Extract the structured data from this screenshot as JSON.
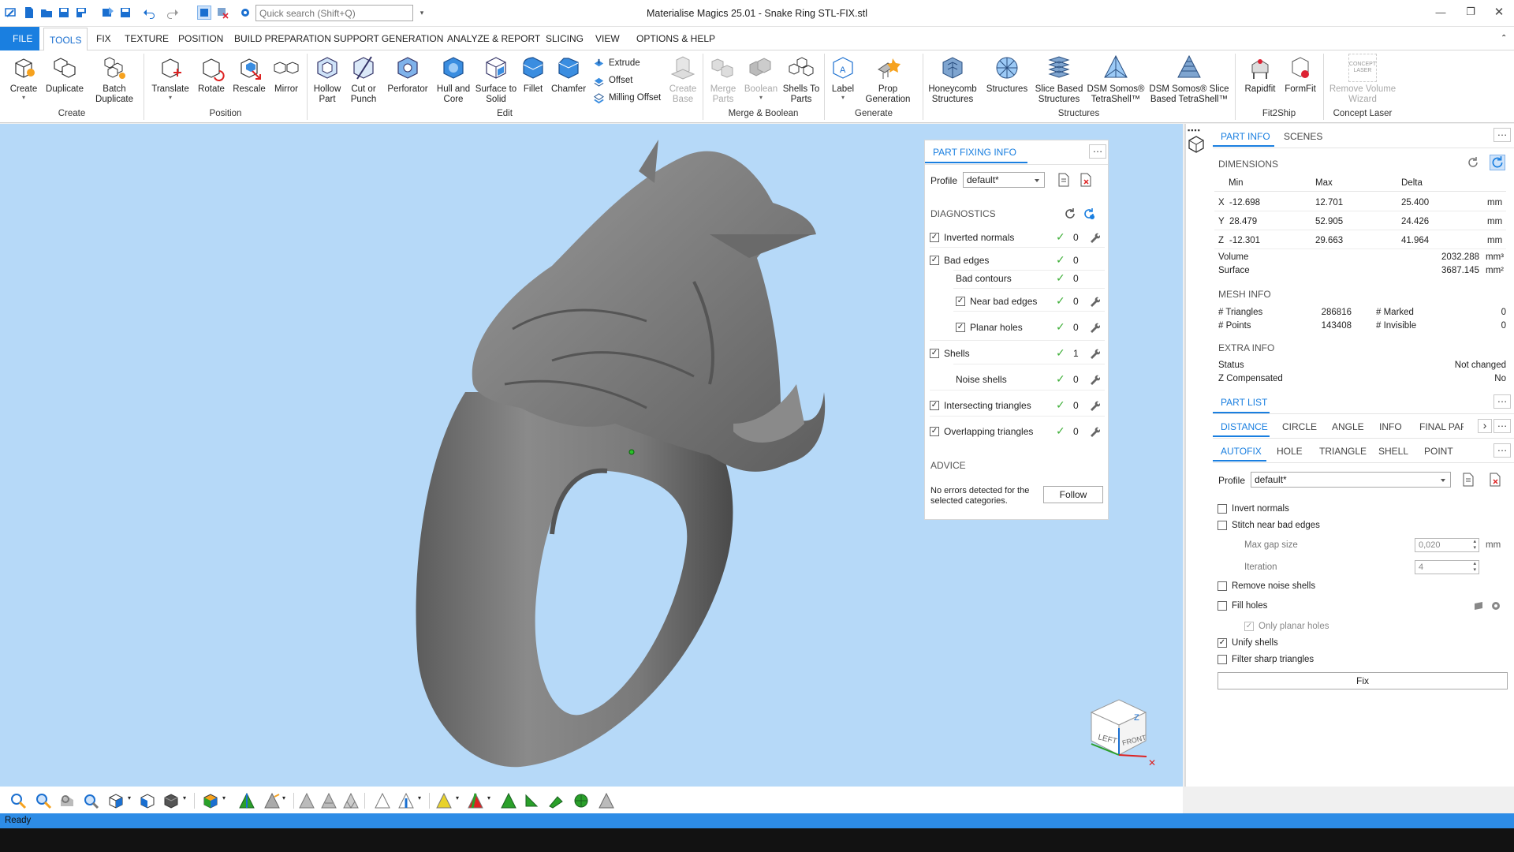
{
  "window": {
    "title": "Materialise Magics 25.01 - Snake Ring STL-FIX.stl",
    "search_placeholder": "Quick search (Shift+Q)"
  },
  "menu": [
    "FILE",
    "TOOLS",
    "FIX",
    "TEXTURE",
    "POSITION",
    "BUILD PREPARATION",
    "SUPPORT GENERATION",
    "ANALYZE & REPORT",
    "SLICING",
    "VIEW",
    "OPTIONS & HELP"
  ],
  "ribbon": {
    "create": {
      "create": "Create",
      "duplicate": "Duplicate",
      "batch_duplicate": "Batch\nDuplicate",
      "group": "Create"
    },
    "position": {
      "translate": "Translate",
      "rotate": "Rotate",
      "rescale": "Rescale",
      "mirror": "Mirror",
      "group": "Position"
    },
    "edit": {
      "hollow": "Hollow\nPart",
      "cut": "Cut or\nPunch",
      "perforator": "Perforator",
      "hull": "Hull and\nCore",
      "surface": "Surface to\nSolid",
      "fillet": "Fillet",
      "chamfer": "Chamfer",
      "extrude": "Extrude",
      "offset": "Offset",
      "milling": "Milling Offset",
      "create_base": "Create\nBase",
      "group": "Edit"
    },
    "merge": {
      "merge_parts": "Merge\nParts",
      "boolean": "Boolean",
      "shells": "Shells To\nParts",
      "group": "Merge & Boolean"
    },
    "generate": {
      "label": "Label",
      "prop": "Prop\nGeneration",
      "group": "Generate"
    },
    "structures": {
      "honeycomb": "Honeycomb\nStructures",
      "structures": "Structures",
      "slice_based": "Slice Based\nStructures",
      "dsm1": "DSM Somos®\nTetraShell™",
      "dsm2": "DSM Somos® Slice\nBased TetraShell™",
      "group": "Structures"
    },
    "fit2ship": {
      "rapidfit": "Rapidfit",
      "formfit": "FormFit",
      "group": "Fit2Ship"
    },
    "concept": {
      "remove": "Remove Volume\nWizard",
      "logo": "CONCEPT\nLASER",
      "group": "Concept Laser"
    }
  },
  "pfi": {
    "title": "PART FIXING INFO",
    "profile_label": "Profile",
    "profile_value": "default*",
    "diagnostics": "DIAGNOSTICS",
    "rows": [
      {
        "label": "Inverted normals",
        "count": "0"
      },
      {
        "label": "Bad edges",
        "count": "0"
      },
      {
        "label": "Bad contours",
        "count": "0"
      },
      {
        "label": "Near bad edges",
        "count": "0"
      },
      {
        "label": "Planar holes",
        "count": "0"
      },
      {
        "label": "Shells",
        "count": "1"
      },
      {
        "label": "Noise shells",
        "count": "0"
      },
      {
        "label": "Intersecting triangles",
        "count": "0"
      },
      {
        "label": "Overlapping triangles",
        "count": "0"
      }
    ],
    "advice": "ADVICE",
    "advice_text": "No errors detected for the\nselected categories.",
    "follow": "Follow"
  },
  "partinfo": {
    "tabs": [
      "PART INFO",
      "SCENES"
    ],
    "dimensions": "DIMENSIONS",
    "cols": [
      "Min",
      "Max",
      "Delta"
    ],
    "rows": [
      {
        "axis": "X",
        "min": "-12.698",
        "max": "12.701",
        "delta": "25.400",
        "unit": "mm"
      },
      {
        "axis": "Y",
        "min": "28.479",
        "max": "52.905",
        "delta": "24.426",
        "unit": "mm"
      },
      {
        "axis": "Z",
        "min": "-12.301",
        "max": "29.663",
        "delta": "41.964",
        "unit": "mm"
      }
    ],
    "volume_label": "Volume",
    "volume": "2032.288",
    "volume_unit": "mm³",
    "surface_label": "Surface",
    "surface": "3687.145",
    "surface_unit": "mm²",
    "mesh": "MESH INFO",
    "triangles_label": "# Triangles",
    "triangles": "286816",
    "points_label": "# Points",
    "points": "143408",
    "marked_label": "# Marked",
    "marked": "0",
    "invisible_label": "# Invisible",
    "invisible": "0",
    "extra": "EXTRA INFO",
    "status_label": "Status",
    "status": "Not changed",
    "zc_label": "Z Compensated",
    "zc": "No"
  },
  "partlist": {
    "title": "PART LIST",
    "tabs": [
      "DISTANCE",
      "CIRCLE",
      "ANGLE",
      "INFO",
      "FINAL PAR"
    ]
  },
  "autofix": {
    "tabs": [
      "AUTOFIX",
      "HOLE",
      "TRIANGLE",
      "SHELL",
      "POINT"
    ],
    "profile_label": "Profile",
    "profile_value": "default*",
    "options": [
      "Invert normals",
      "Stitch near bad edges",
      "Remove noise shells",
      "Fill holes",
      "Unify shells",
      "Filter sharp triangles"
    ],
    "max_gap_label": "Max gap size",
    "max_gap": "0,020",
    "max_gap_unit": "mm",
    "iteration_label": "Iteration",
    "iteration": "4",
    "only_planar": "Only planar holes",
    "fix": "Fix"
  },
  "viewcube": {
    "left": "LEFT",
    "front": "FRONT",
    "z": "Z"
  },
  "status": "Ready"
}
